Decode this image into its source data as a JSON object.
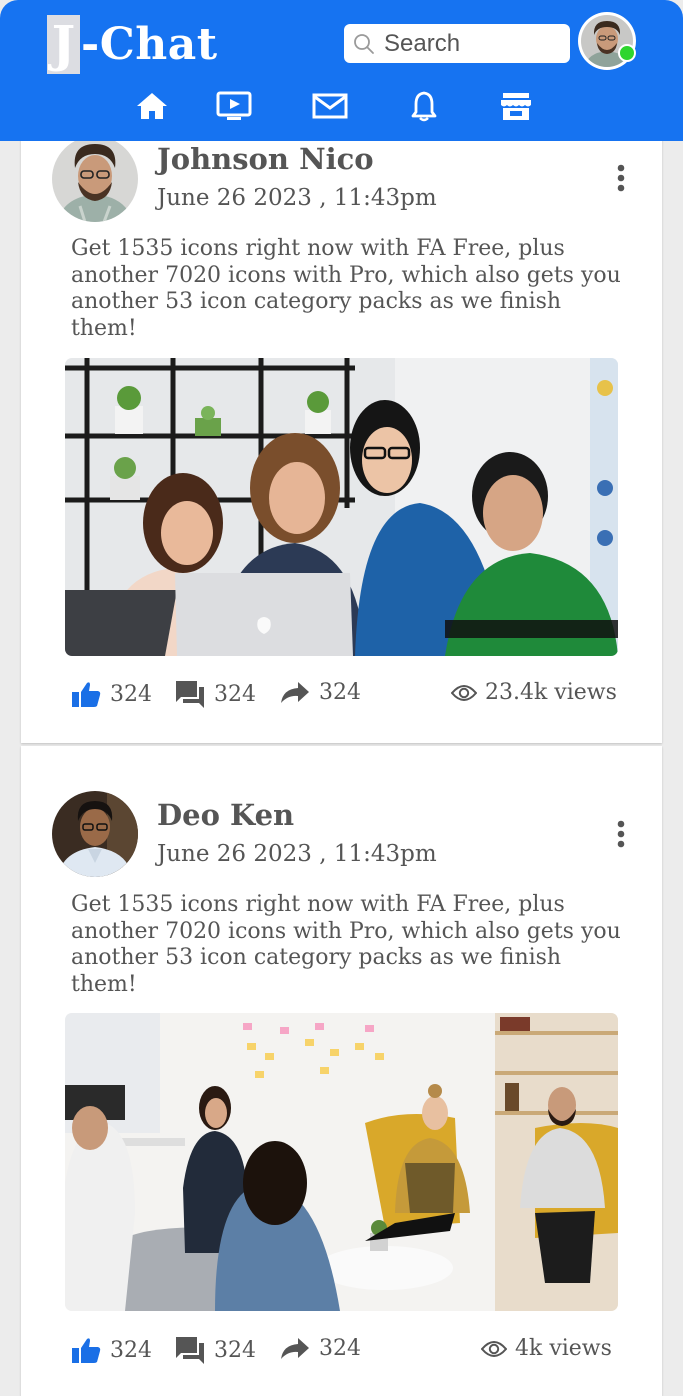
{
  "app": {
    "logo_letter": "J",
    "logo_text": "-Chat",
    "search_placeholder": "Search"
  },
  "nav": {
    "icons": [
      "home-icon",
      "video-icon",
      "mail-icon",
      "bell-icon",
      "store-icon"
    ]
  },
  "colors": {
    "header": "#1673f1",
    "like": "#1a6fe6",
    "online": "#2ed52e",
    "text": "#555555"
  },
  "posts": [
    {
      "author": "Johnson Nico",
      "date": "June 26 2023 , 11:43pm",
      "text": "Get 1535 icons right now with FA Free, plus another 7020 icons with Pro, which also gets you another 53 icon category packs as we finish them!",
      "likes": "324",
      "comments": "324",
      "shares": "324",
      "views": "23.4k views"
    },
    {
      "author": "Deo Ken",
      "date": "June 26 2023 , 11:43pm",
      "text": "Get 1535 icons right now with FA Free, plus another 7020 icons with Pro, which also gets you another 53 icon category packs as we finish them!",
      "likes": "324",
      "comments": "324",
      "shares": "324",
      "views": "4k views"
    }
  ]
}
